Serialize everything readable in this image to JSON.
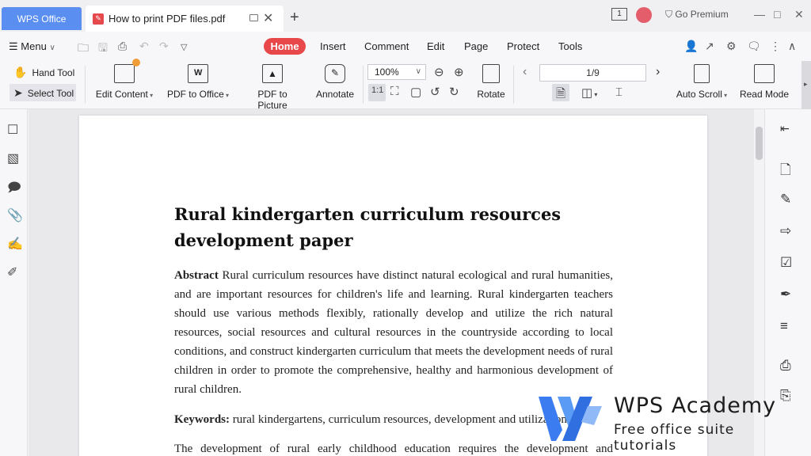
{
  "titlebar": {
    "app_tab": "WPS Office",
    "doc_tab": "How to print PDF files.pdf",
    "badge": "1",
    "premium": "Go Premium"
  },
  "menubar": {
    "menu_label": "Menu",
    "tabs": [
      "Home",
      "Insert",
      "Comment",
      "Edit",
      "Page",
      "Protect",
      "Tools"
    ]
  },
  "ribbon": {
    "hand_tool": "Hand Tool",
    "select_tool": "Select Tool",
    "edit_content": "Edit Content",
    "pdf_to_office": "PDF to Office",
    "pdf_to_picture": "PDF to Picture",
    "annotate": "Annotate",
    "zoom": "100%",
    "rotate": "Rotate",
    "page_indicator": "1/9",
    "auto_scroll": "Auto Scroll",
    "read_mode": "Read Mode"
  },
  "document": {
    "title_line1": "Rural kindergarten curriculum resources",
    "title_line2": "development paper",
    "abstract_label": "Abstract",
    "abstract_text": " Rural curriculum resources have distinct natural ecological and rural humanities, and are important resources for children's life and learning. Rural kindergarten teachers should use various methods flexibly, rationally develop and utilize the rich natural resources, social resources and cultural resources in the countryside according to local conditions, and construct kindergarten curriculum that meets the development needs of rural children in order to promote the comprehensive, healthy and harmonious development of rural children.",
    "keywords_label": "Keywords:",
    "keywords_text": " rural kindergartens, curriculum resources, development and utilization.",
    "body_start": "The development of rural early childhood education requires the development and"
  },
  "watermark": {
    "title": "WPS Academy",
    "subtitle": "Free office suite tutorials"
  },
  "colors": {
    "accent_red": "#e9484a",
    "wps_tab_blue": "#5a8ef0",
    "watermark_blue": "#3b7cf0"
  }
}
